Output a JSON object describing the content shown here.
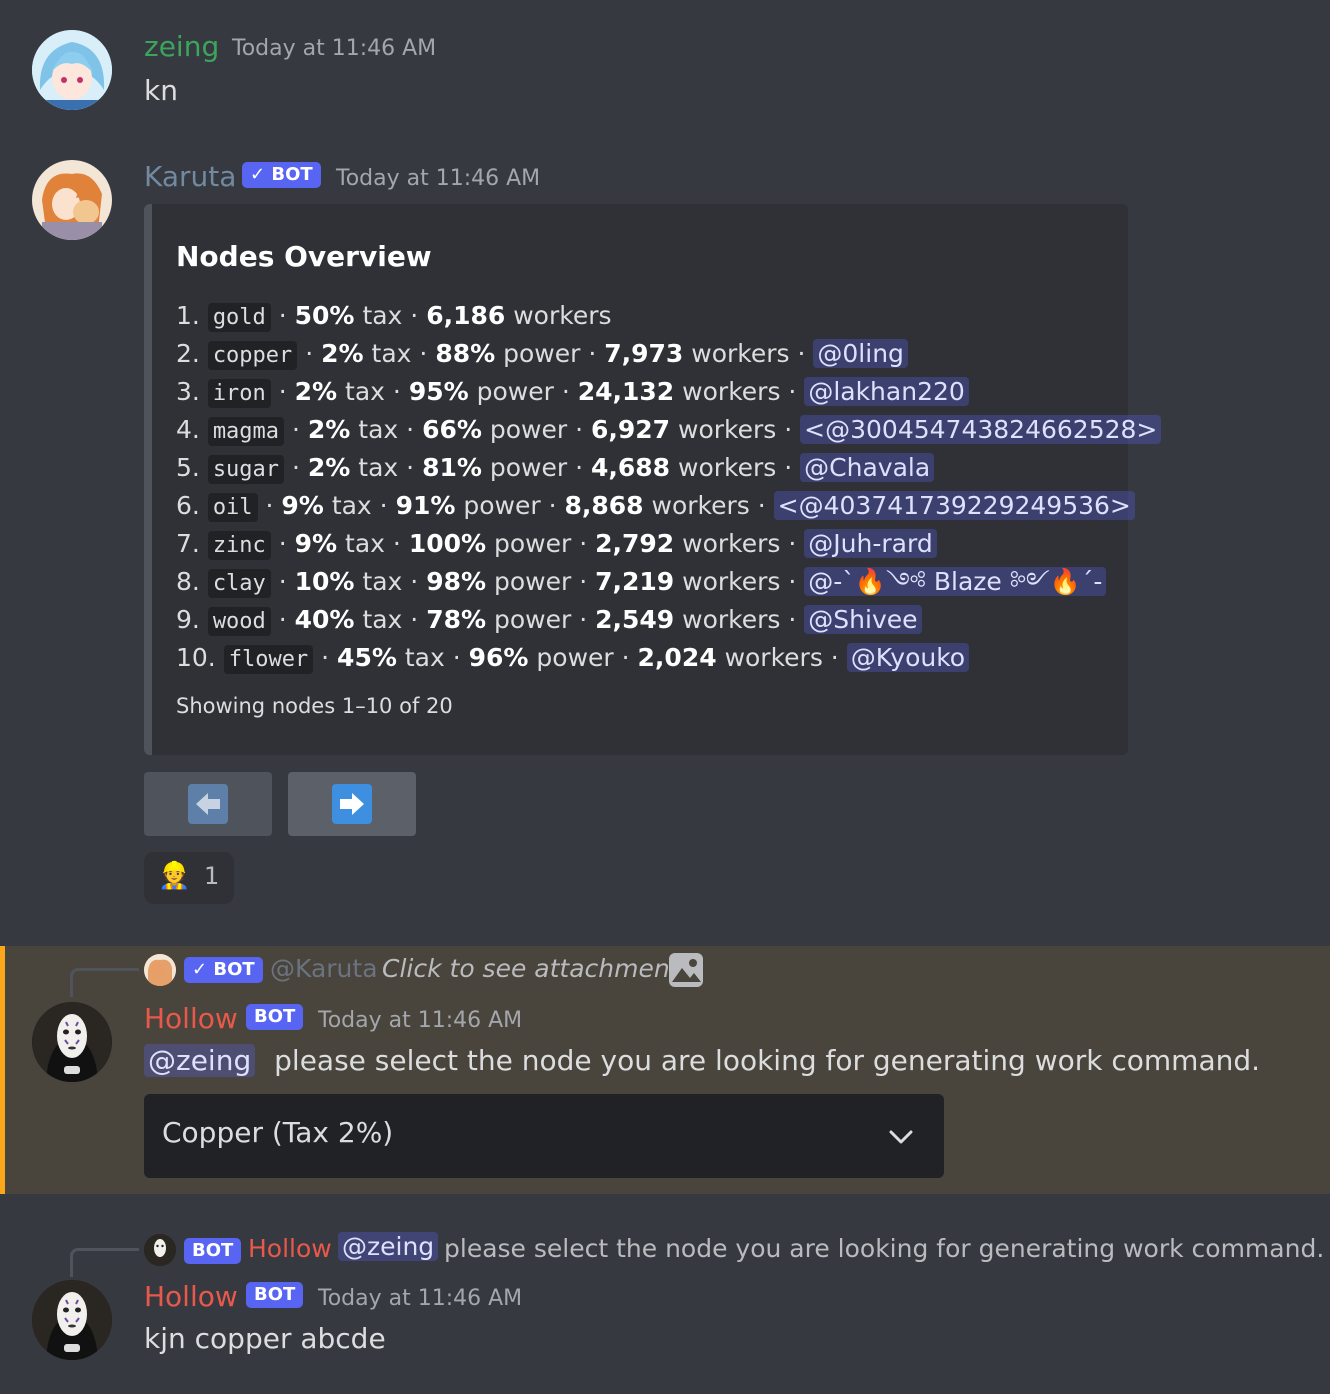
{
  "colors": {
    "background": "#36393f",
    "embed_bg": "#2f3136",
    "mention_bg": "#414675",
    "bot_badge": "#5865f2",
    "zeing_name": "#3ba55d",
    "karuta_name": "#7289a0",
    "hollow_name": "#e8594b",
    "highlight_bg": "#49443c",
    "highlight_bar": "#faa81a"
  },
  "messages": {
    "m1": {
      "author": "zeing",
      "timestamp": "Today at 11:46 AM",
      "content": "kn"
    },
    "m2": {
      "author": "Karuta",
      "badge": "✓ BOT",
      "timestamp": "Today at 11:46 AM",
      "embed": {
        "title": "Nodes Overview",
        "rows": [
          {
            "n": "1.",
            "node": "gold",
            "tax": "50%",
            "tax_label": "tax",
            "workers": "6,186",
            "workers_label": "workers"
          },
          {
            "n": "2.",
            "node": "copper",
            "tax": "2%",
            "tax_label": "tax",
            "power": "88%",
            "power_label": "power",
            "workers": "7,973",
            "workers_label": "workers",
            "owner": "@0ling"
          },
          {
            "n": "3.",
            "node": "iron",
            "tax": "2%",
            "tax_label": "tax",
            "power": "95%",
            "power_label": "power",
            "workers": "24,132",
            "workers_label": "workers",
            "owner": "@lakhan220"
          },
          {
            "n": "4.",
            "node": "magma",
            "tax": "2%",
            "tax_label": "tax",
            "power": "66%",
            "power_label": "power",
            "workers": "6,927",
            "workers_label": "workers",
            "owner": "<@300454743824662528>"
          },
          {
            "n": "5.",
            "node": "sugar",
            "tax": "2%",
            "tax_label": "tax",
            "power": "81%",
            "power_label": "power",
            "workers": "4,688",
            "workers_label": "workers",
            "owner": "@Chavala"
          },
          {
            "n": "6.",
            "node": "oil",
            "tax": "9%",
            "tax_label": "tax",
            "power": "91%",
            "power_label": "power",
            "workers": "8,868",
            "workers_label": "workers",
            "owner": "<@403741739229249536>"
          },
          {
            "n": "7.",
            "node": "zinc",
            "tax": "9%",
            "tax_label": "tax",
            "power": "100%",
            "power_label": "power",
            "workers": "2,792",
            "workers_label": "workers",
            "owner": "@Juh-rard"
          },
          {
            "n": "8.",
            "node": "clay",
            "tax": "10%",
            "tax_label": "tax",
            "power": "98%",
            "power_label": "power",
            "workers": "7,219",
            "workers_label": "workers",
            "owner": "@-`🔥༺ Blaze ༻🔥´-"
          },
          {
            "n": "9.",
            "node": "wood",
            "tax": "40%",
            "tax_label": "tax",
            "power": "78%",
            "power_label": "power",
            "workers": "2,549",
            "workers_label": "workers",
            "owner": "@Shivee"
          },
          {
            "n": "10.",
            "node": "flower",
            "tax": "45%",
            "tax_label": "tax",
            "power": "96%",
            "power_label": "power",
            "workers": "2,024",
            "workers_label": "workers",
            "owner": "@Kyouko"
          }
        ],
        "footer": "Showing nodes 1–10 of 20"
      },
      "buttons": {
        "prev_icon": "arrow-left-icon",
        "next_icon": "arrow-right-icon"
      },
      "reaction": {
        "emoji": "👷",
        "count": "1"
      }
    },
    "m3": {
      "reply": {
        "badge": "✓ BOT",
        "author": "@Karuta",
        "content": "Click to see attachment",
        "icon": "image-icon"
      },
      "author": "Hollow",
      "badge": "BOT",
      "timestamp": "Today at 11:46 AM",
      "mention": "@zeing",
      "content": "please select the node you are looking for generating work command.",
      "select_value": "Copper (Tax 2%)"
    },
    "m4": {
      "reply": {
        "badge": "BOT",
        "author": "Hollow",
        "mention": "@zeing",
        "content": "please select the node you are looking for generating work command."
      },
      "author": "Hollow",
      "badge": "BOT",
      "timestamp": "Today at 11:46 AM",
      "content": "kjn copper abcde"
    }
  }
}
